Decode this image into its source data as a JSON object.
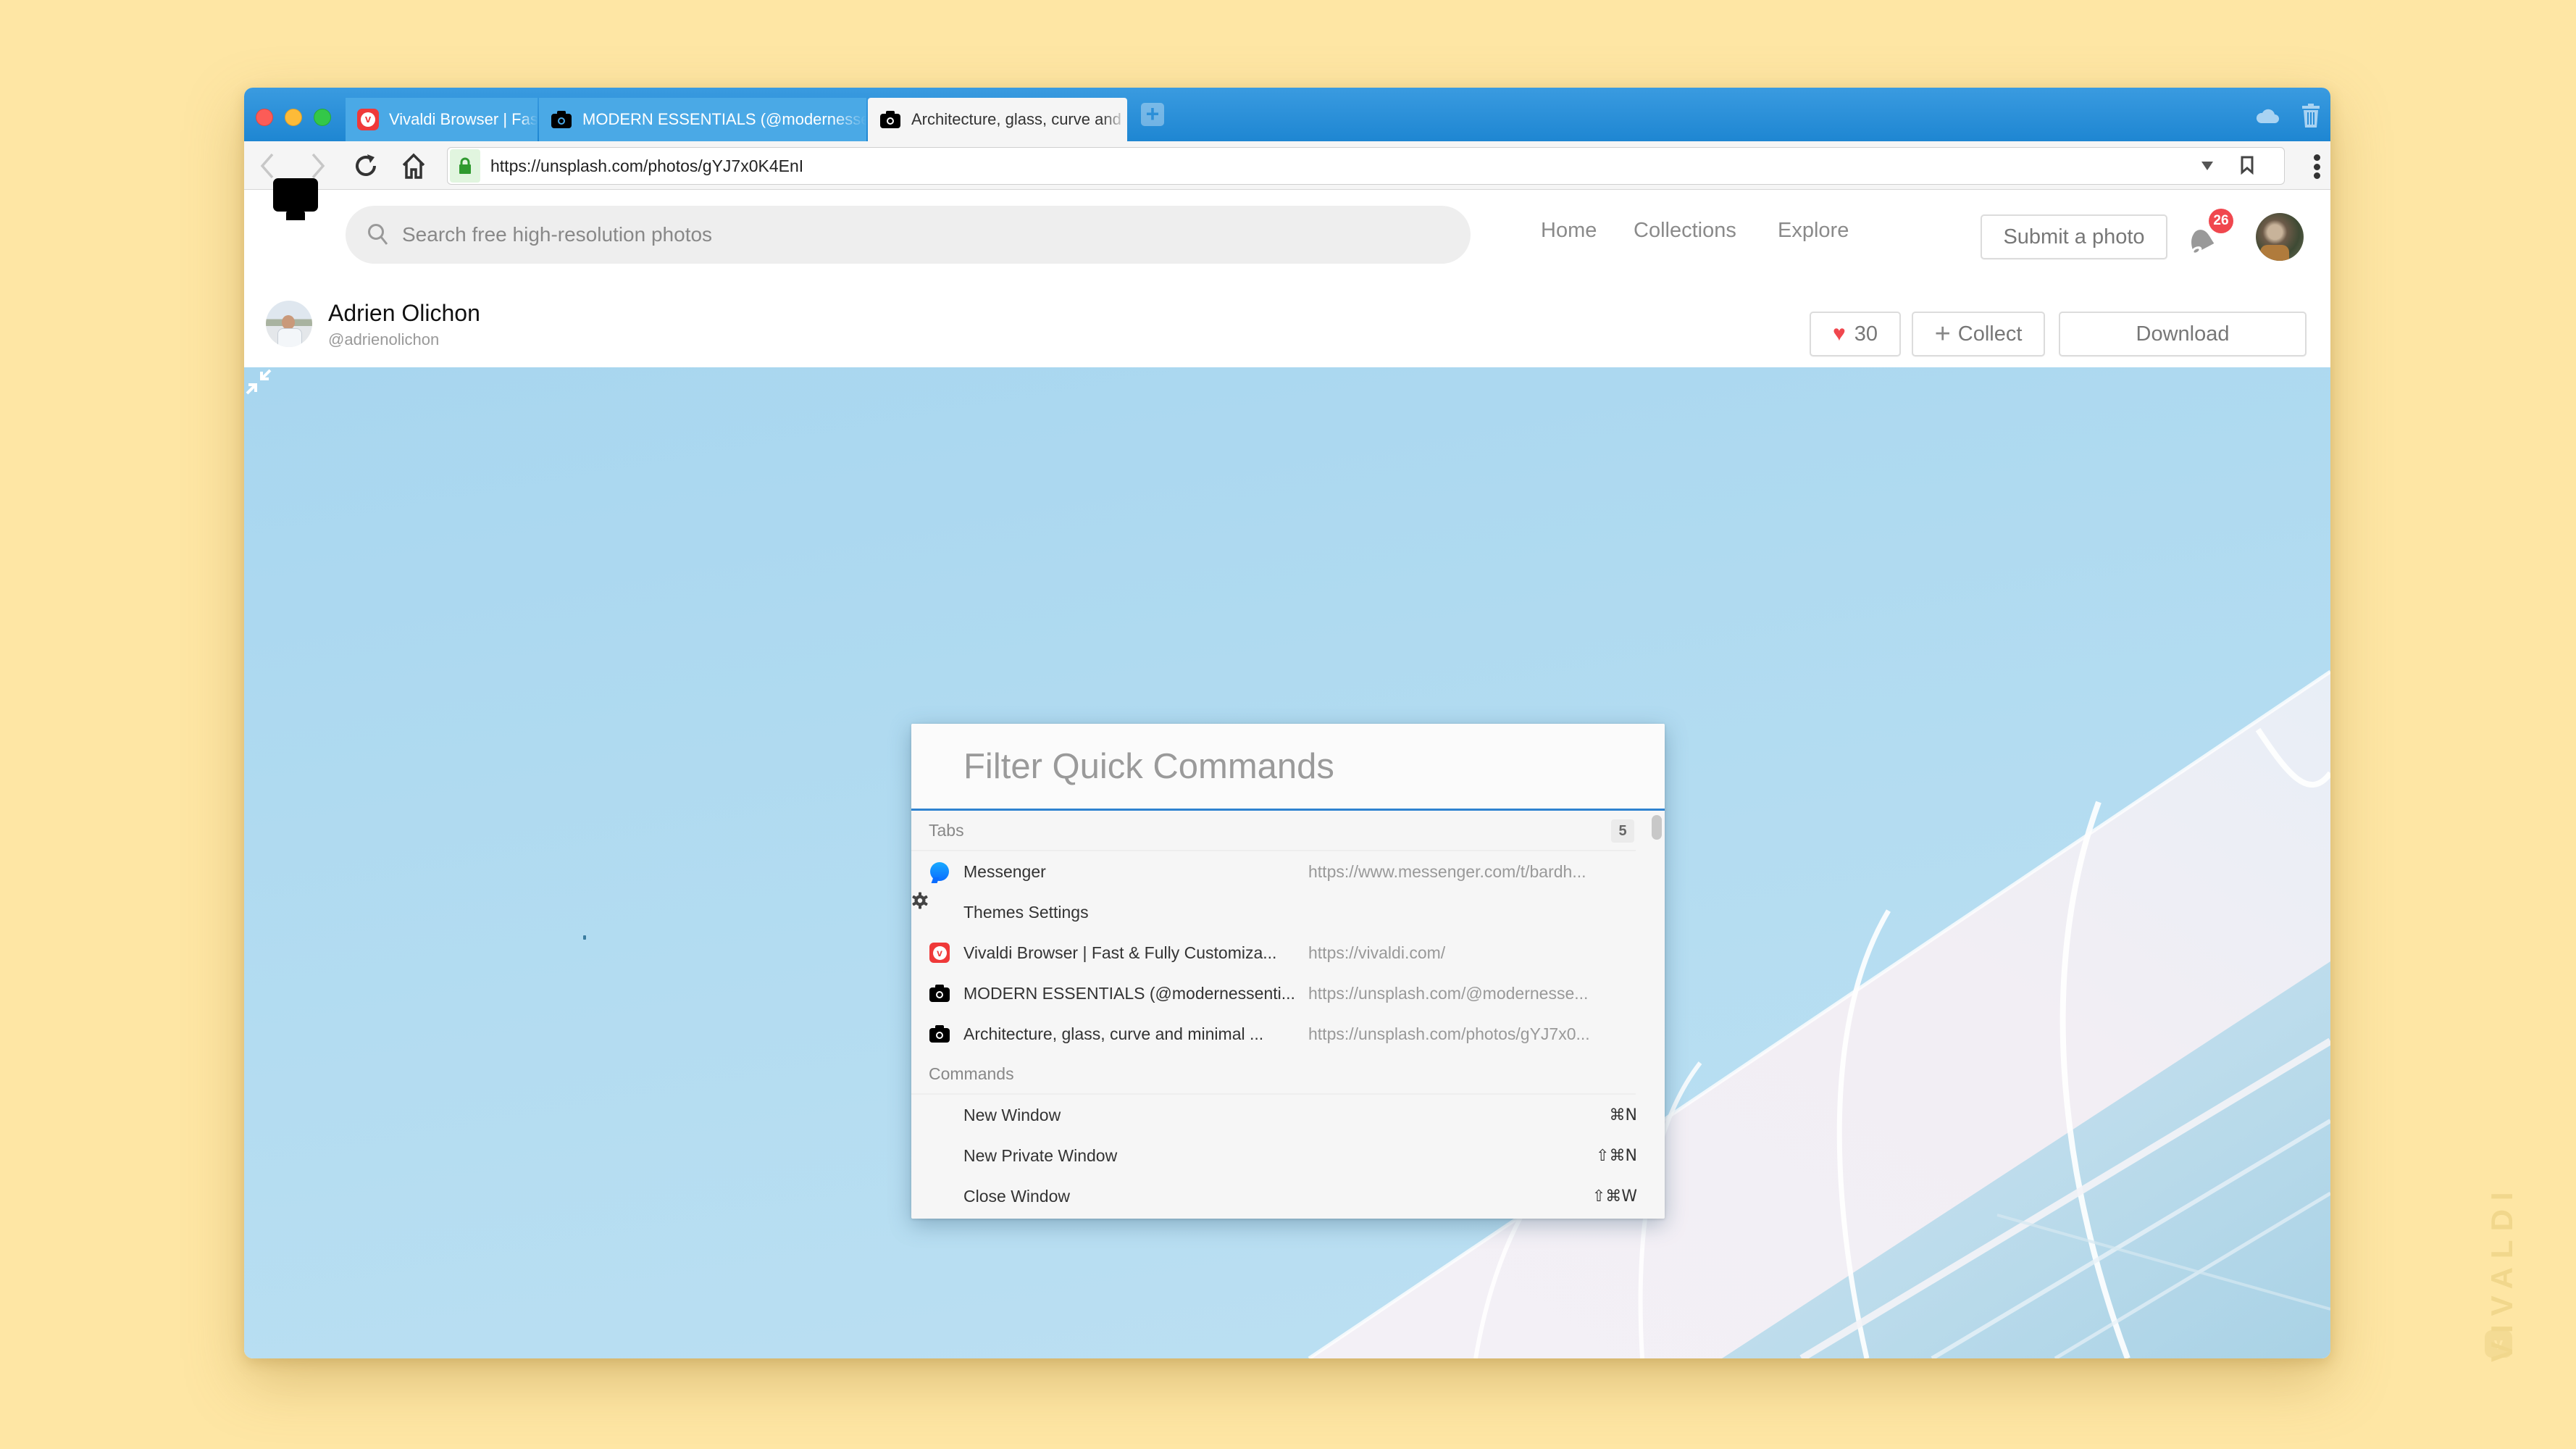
{
  "browser": {
    "tabs": [
      {
        "title": "Vivaldi Browser | Fast & Fully Customizable",
        "icon": "vivaldi-icon",
        "active": false
      },
      {
        "title": "MODERN ESSENTIALS (@modernessentials)",
        "icon": "camera-icon",
        "active": false
      },
      {
        "title": "Architecture, glass, curve and minimal",
        "icon": "camera-icon",
        "active": true
      }
    ],
    "new_tab_label": "+",
    "address_bar": {
      "url": "https://unsplash.com/photos/gYJ7x0K4EnI",
      "secure": true
    },
    "colors": {
      "tabbar": "#2b8fd8",
      "close": "#fc5c57",
      "minimize": "#fdbb38",
      "maximize": "#33c748",
      "desktop": "#fee6a4"
    }
  },
  "site": {
    "search": {
      "placeholder": "Search free high-resolution photos"
    },
    "nav": [
      {
        "label": "Home"
      },
      {
        "label": "Collections"
      },
      {
        "label": "Explore"
      }
    ],
    "submit_label": "Submit a photo",
    "notification_count": "26",
    "author": {
      "name": "Adrien Olichon",
      "handle": "@adrienolichon"
    },
    "likes": "30",
    "collect_label": "Collect",
    "download_label": "Download"
  },
  "quick_commands": {
    "placeholder": "Filter Quick Commands",
    "tabs_section": {
      "label": "Tabs",
      "count": "5"
    },
    "tab_items": [
      {
        "title": "Messenger",
        "url": "https://www.messenger.com/t/bardh...",
        "icon": "messenger-icon"
      },
      {
        "title": "Themes Settings",
        "url": "",
        "icon": "gear-icon"
      },
      {
        "title": "Vivaldi Browser | Fast & Fully Customiza...",
        "url": "https://vivaldi.com/",
        "icon": "vivaldi-icon"
      },
      {
        "title": "MODERN ESSENTIALS (@modernessenti...",
        "url": "https://unsplash.com/@modernesse...",
        "icon": "camera-icon"
      },
      {
        "title": "Architecture, glass, curve and minimal ...",
        "url": "https://unsplash.com/photos/gYJ7x0...",
        "icon": "camera-icon"
      }
    ],
    "commands_section": {
      "label": "Commands"
    },
    "command_items": [
      {
        "title": "New Window",
        "shortcut": "⌘N"
      },
      {
        "title": "New Private Window",
        "shortcut": "⇧⌘N"
      },
      {
        "title": "Close Window",
        "shortcut": "⇧⌘W"
      }
    ]
  },
  "watermark": {
    "text": "VIVALDI"
  }
}
